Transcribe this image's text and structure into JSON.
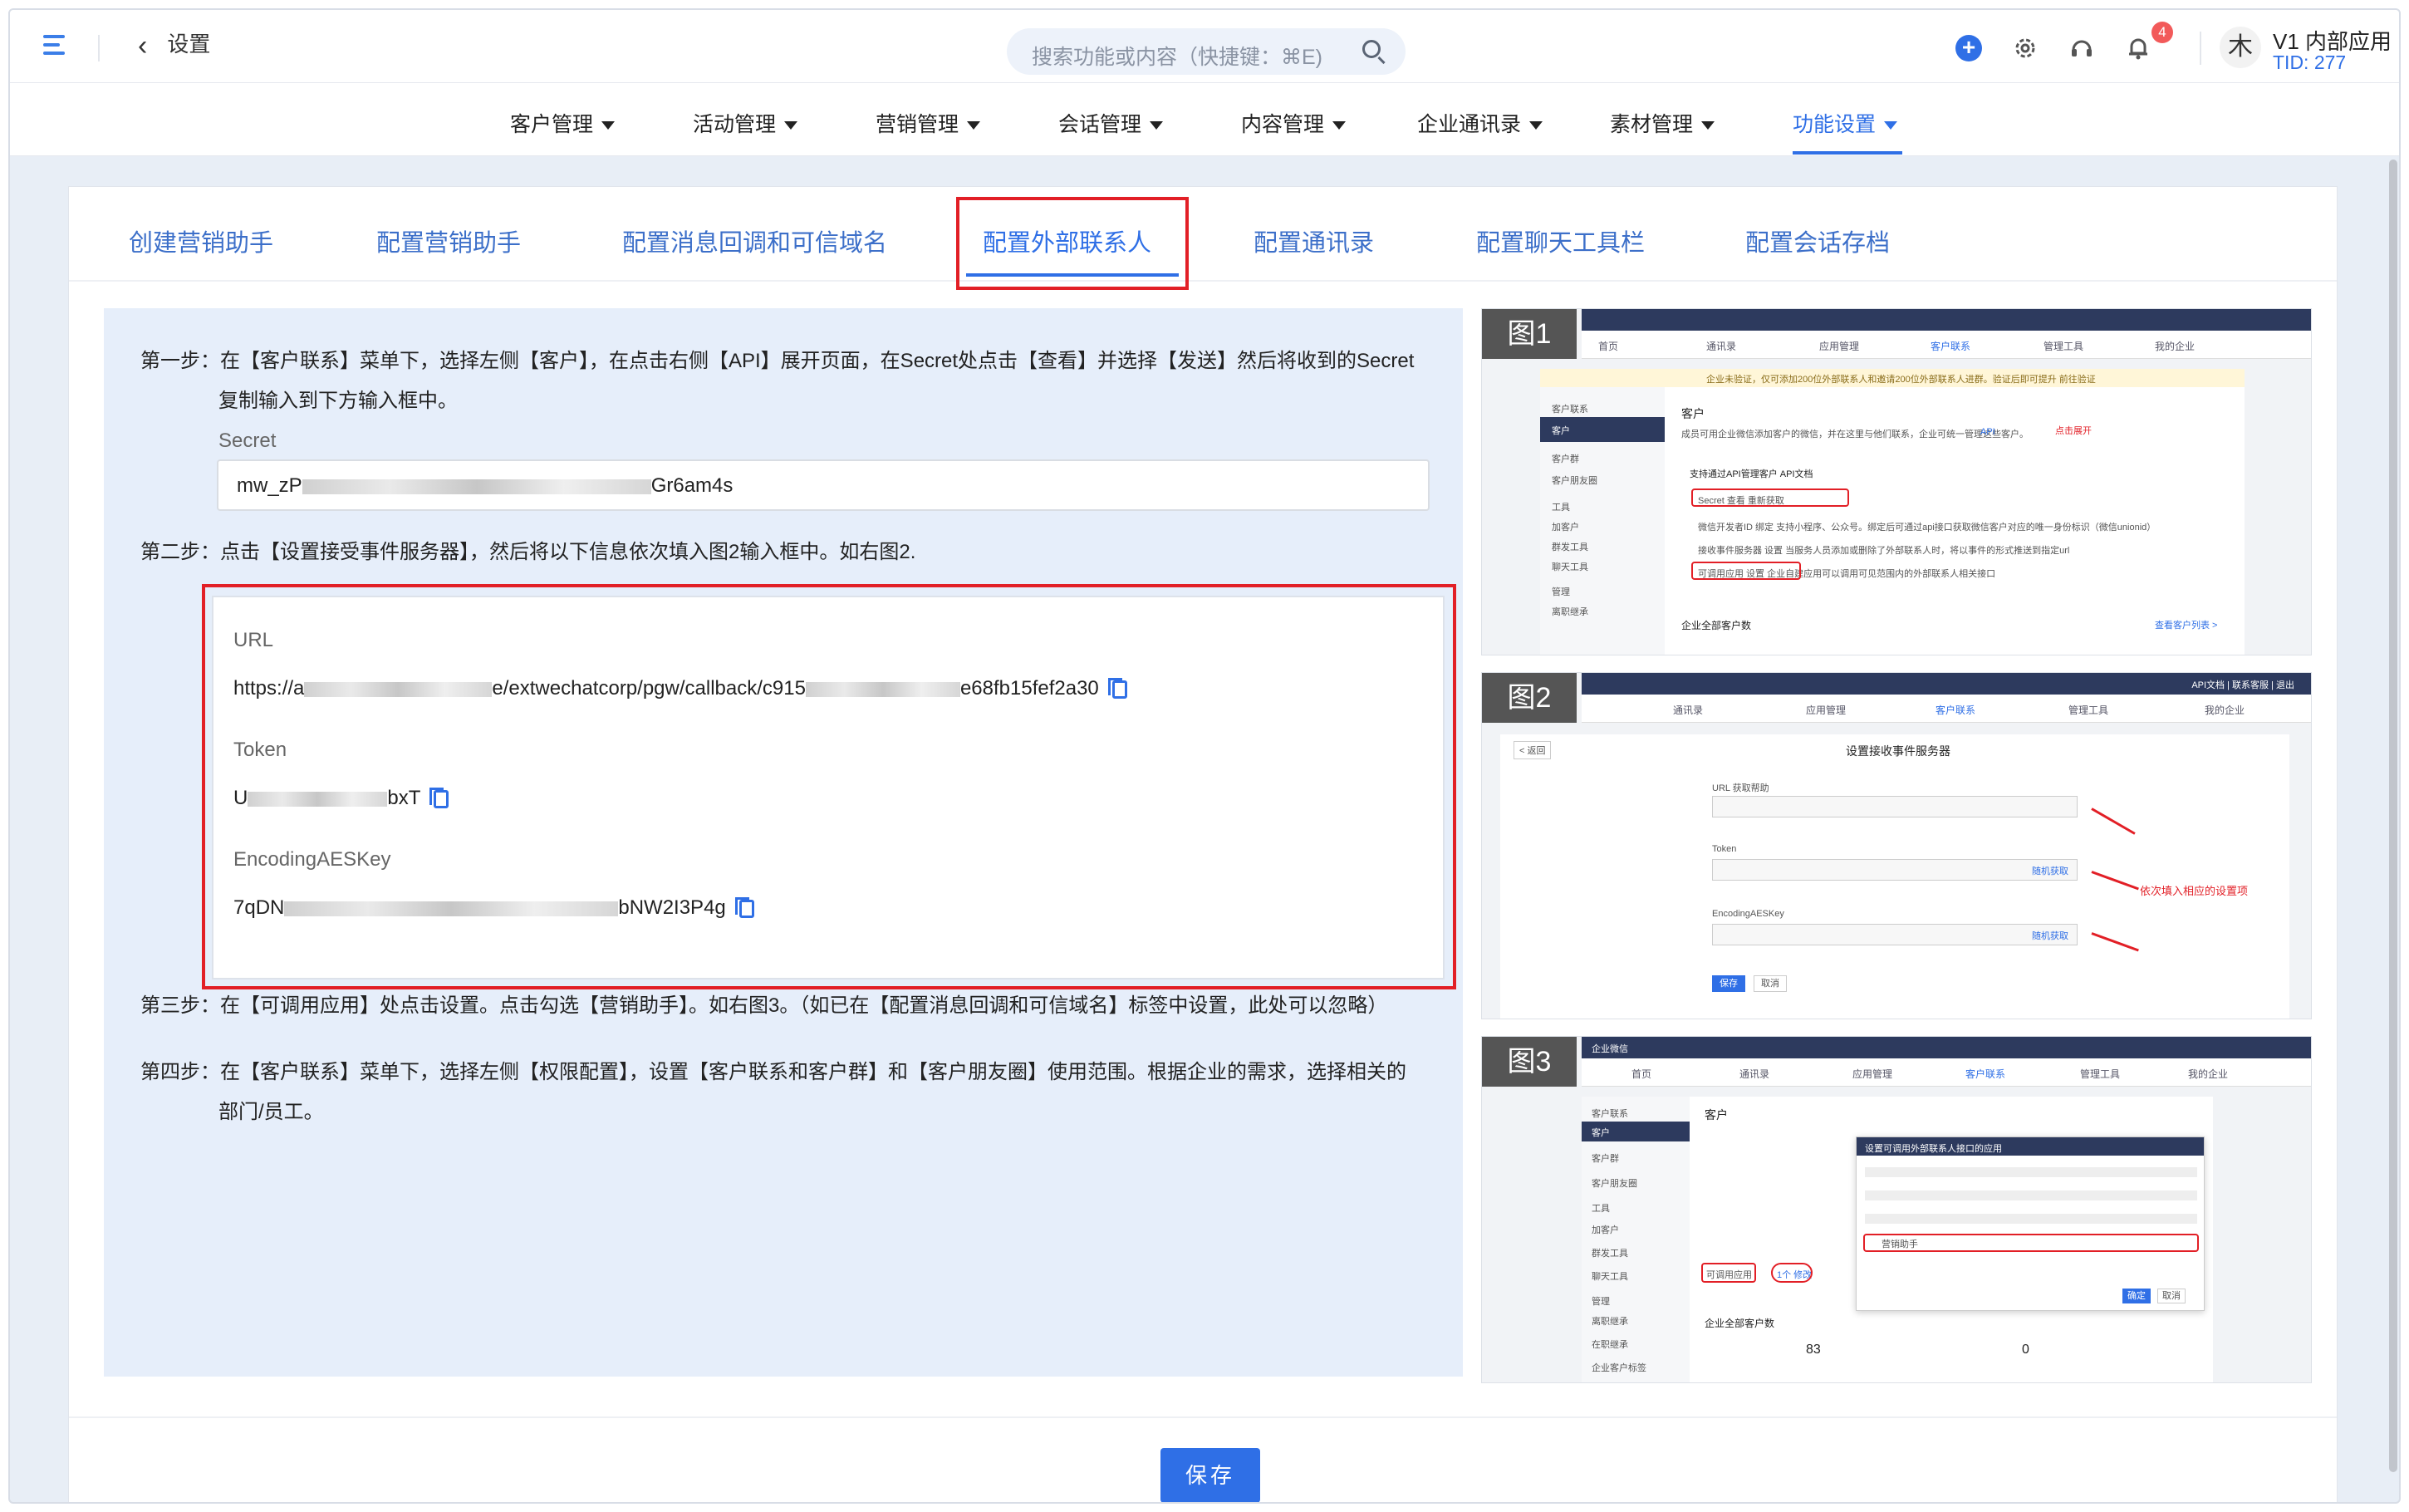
{
  "header": {
    "back_label": "设置",
    "search_placeholder": "搜索功能或内容（快捷键：⌘E)",
    "notification_count": "4",
    "avatar_char": "木",
    "app_name": "V1 内部应用",
    "tid": "TID: 277"
  },
  "nav": {
    "items": [
      "客户管理",
      "活动管理",
      "营销管理",
      "会话管理",
      "内容管理",
      "企业通讯录",
      "素材管理",
      "功能设置"
    ],
    "active": "功能设置"
  },
  "tabs": {
    "items": [
      "创建营销助手",
      "配置营销助手",
      "配置消息回调和可信域名",
      "配置外部联系人",
      "配置通讯录",
      "配置聊天工具栏",
      "配置会话存档"
    ],
    "active": "配置外部联系人"
  },
  "steps": {
    "step1_line1": "第一步：在【客户联系】菜单下，选择左侧【客户】，在点击右侧【API】展开页面，在Secret处点击【查看】并选择【发送】然后将收到的Secret",
    "step1_line2": "复制输入到下方输入框中。",
    "secret_label": "Secret",
    "secret_prefix": "mw_zP",
    "secret_suffix": "Gr6am4s",
    "step2": "第二步：点击【设置接受事件服务器】，然后将以下信息依次填入图2输入框中。如右图2.",
    "url_label": "URL",
    "url_prefix": "https://a",
    "url_middle": "e/extwechatcorp/pgw/callback/c915",
    "url_suffix": "e68fb15fef2a30",
    "token_label": "Token",
    "token_prefix": "U",
    "token_suffix": "bxT",
    "aes_label": "EncodingAESKey",
    "aes_prefix": "7qDN",
    "aes_suffix": "bNW2I3P4g",
    "step3": "第三步：在【可调用应用】处点击设置。点击勾选【营销助手】。如右图3。（如已在【配置消息回调和可信域名】标签中设置，此处可以忽略）",
    "step4_line1": "第四步：在【客户联系】菜单下，选择左侧【权限配置】，设置【客户联系和客户群】和【客户朋友圈】使用范围。根据企业的需求，选择相关的",
    "step4_line2": "部门/员工。"
  },
  "figures": {
    "fig1": {
      "tag": "图1",
      "tabs": [
        "首页",
        "通讯录",
        "应用管理",
        "客户联系",
        "管理工具",
        "我的企业"
      ],
      "notice": "企业未验证，仅可添加200位外部联系人和邀请200位外部联系人进群。验证后即可提升  前往验证",
      "sidebar": [
        "客户联系",
        "客户",
        "客户群",
        "客户朋友圈",
        "工具",
        "加客户",
        "群发工具",
        "聊天工具",
        "管理",
        "离职继承"
      ],
      "title": "客户",
      "desc": "成员可用企业微信添加客户的微信，并在这里与他们联系，企业可统一管理这些客户。",
      "api_tag": "API",
      "click_hint": "点击展开",
      "api_section": "支持通过API管理客户  API文档",
      "rows": [
        "Secret   查看  重新获取",
        "微信开发者ID   绑定  支持小程序、公众号。绑定后可通过api接口获取微信客户对应的唯一身份标识（微信unionid）",
        "接收事件服务器   设置  当服务人员添加或删除了外部联系人时，将以事件的形式推送到指定url",
        "可调用应用   设置  企业自建应用可以调用可见范围内的外部联系人相关接口"
      ],
      "footer": "企业全部客户数",
      "footer_link": "查看客户列表 >"
    },
    "fig2": {
      "tag": "图2",
      "tabs": [
        "通讯录",
        "应用管理",
        "客户联系",
        "管理工具",
        "我的企业"
      ],
      "top_links": "API文档 | 联系客服 | 退出",
      "back_btn": "< 返回",
      "title": "设置接收事件服务器",
      "url_label": "URL  获取帮助",
      "token_label": "Token",
      "aes_label": "EncodingAESKey",
      "random_btn": "随机获取",
      "hint": "依次填入相应的设置项",
      "save_btn": "保存",
      "cancel_btn": "取消"
    },
    "fig3": {
      "tag": "图3",
      "brand": "企业微信",
      "tabs": [
        "首页",
        "通讯录",
        "应用管理",
        "客户联系",
        "管理工具",
        "我的企业"
      ],
      "sidebar": [
        "客户联系",
        "客户",
        "客户群",
        "客户朋友圈",
        "工具",
        "加客户",
        "群发工具",
        "聊天工具",
        "管理",
        "离职继承",
        "在职继承",
        "企业客户标签"
      ],
      "title": "客户",
      "dialog_title": "设置可调用外部联系人接口的应用",
      "dialog_item": "营销助手",
      "confirm_btn": "确定",
      "cancel_btn": "取消",
      "call_app": "可调用应用",
      "count_link": "1个 修改",
      "footer": "企业全部客户数",
      "stat_a": "83",
      "stat_b": "0"
    }
  },
  "save_button": "保存",
  "colors": {
    "primary": "#2f6fe6",
    "highlight_red": "#e21f26",
    "panel_bg": "#e6eefa"
  }
}
